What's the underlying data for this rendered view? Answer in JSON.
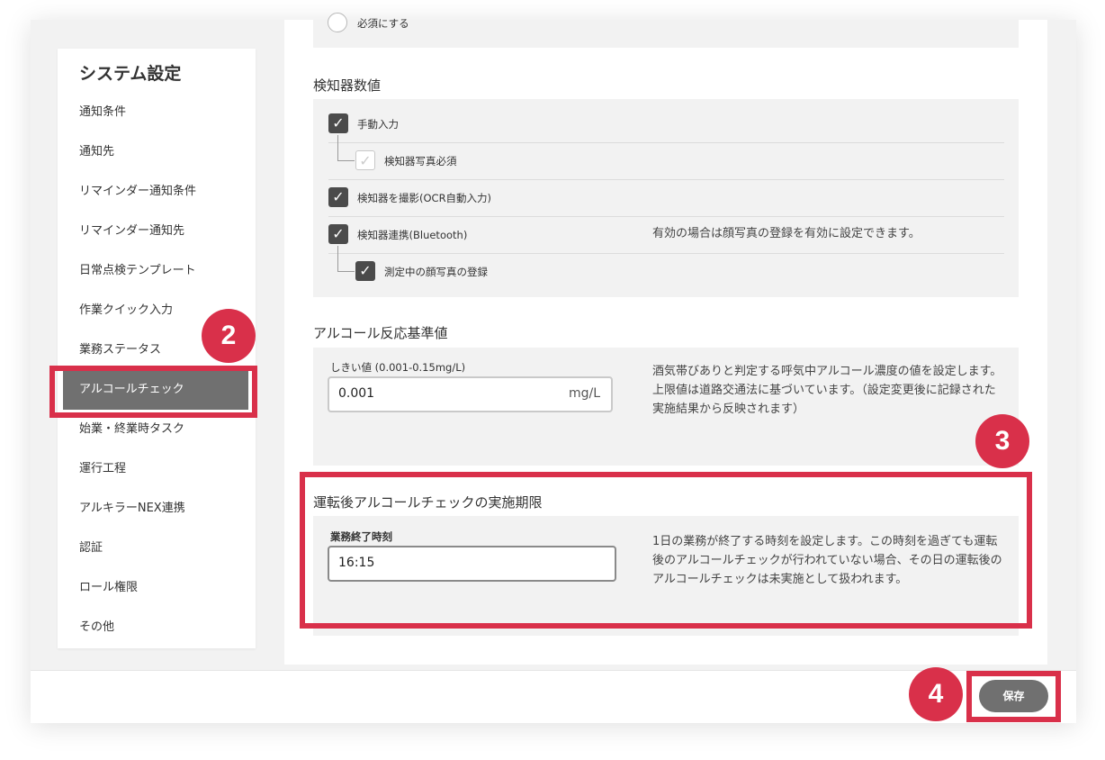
{
  "sidebar": {
    "title": "システム設定",
    "items": [
      {
        "label": "通知条件"
      },
      {
        "label": "通知先"
      },
      {
        "label": "リマインダー通知条件"
      },
      {
        "label": "リマインダー通知先"
      },
      {
        "label": "日常点検テンプレート"
      },
      {
        "label": "作業クイック入力"
      },
      {
        "label": "業務ステータス"
      },
      {
        "label": "アルコールチェック",
        "active": true
      },
      {
        "label": "始業・終業時タスク"
      },
      {
        "label": "運行工程"
      },
      {
        "label": "アルキラーNEX連携"
      },
      {
        "label": "認証"
      },
      {
        "label": "ロール権限"
      },
      {
        "label": "その他"
      }
    ]
  },
  "top_panel": {
    "radio_label": "必須にする"
  },
  "detector": {
    "title": "検知器数値",
    "manual_input": {
      "label": "手動入力",
      "checked": true
    },
    "photo_required": {
      "label": "検知器写真必須",
      "checked": false
    },
    "ocr": {
      "label": "検知器を撮影(OCR自動入力)",
      "checked": true
    },
    "bluetooth": {
      "label": "検知器連携(Bluetooth)",
      "checked": true,
      "note": "有効の場合は顔写真の登録を有効に設定できます。"
    },
    "face_photo": {
      "label": "測定中の顔写真の登録",
      "checked": true
    }
  },
  "threshold": {
    "title": "アルコール反応基準値",
    "field_label": "しきい値 (0.001-0.15mg/L)",
    "value": "0.001",
    "unit": "mg/L",
    "note": "酒気帯びありと判定する呼気中アルコール濃度の値を設定します。上限値は道路交通法に基づいています。（設定変更後に記録された実施結果から反映されます）"
  },
  "deadline": {
    "title": "運転後アルコールチェックの実施期限",
    "field_label": "業務終了時刻",
    "value": "16:15",
    "note": "1日の業務が終了する時刻を設定します。この時刻を過ぎても運転後のアルコールチェックが行われていない場合、その日の運転後のアルコールチェックは未実施として扱われます。"
  },
  "footer": {
    "save_label": "保存"
  },
  "steps": {
    "s2": "2",
    "s3": "3",
    "s4": "4"
  },
  "colors": {
    "highlight": "#d9304a",
    "active_item": "#707070",
    "checkbox": "#4b4b4b"
  },
  "icons": {
    "checkmark": "check-icon",
    "radio": "radio-icon"
  }
}
